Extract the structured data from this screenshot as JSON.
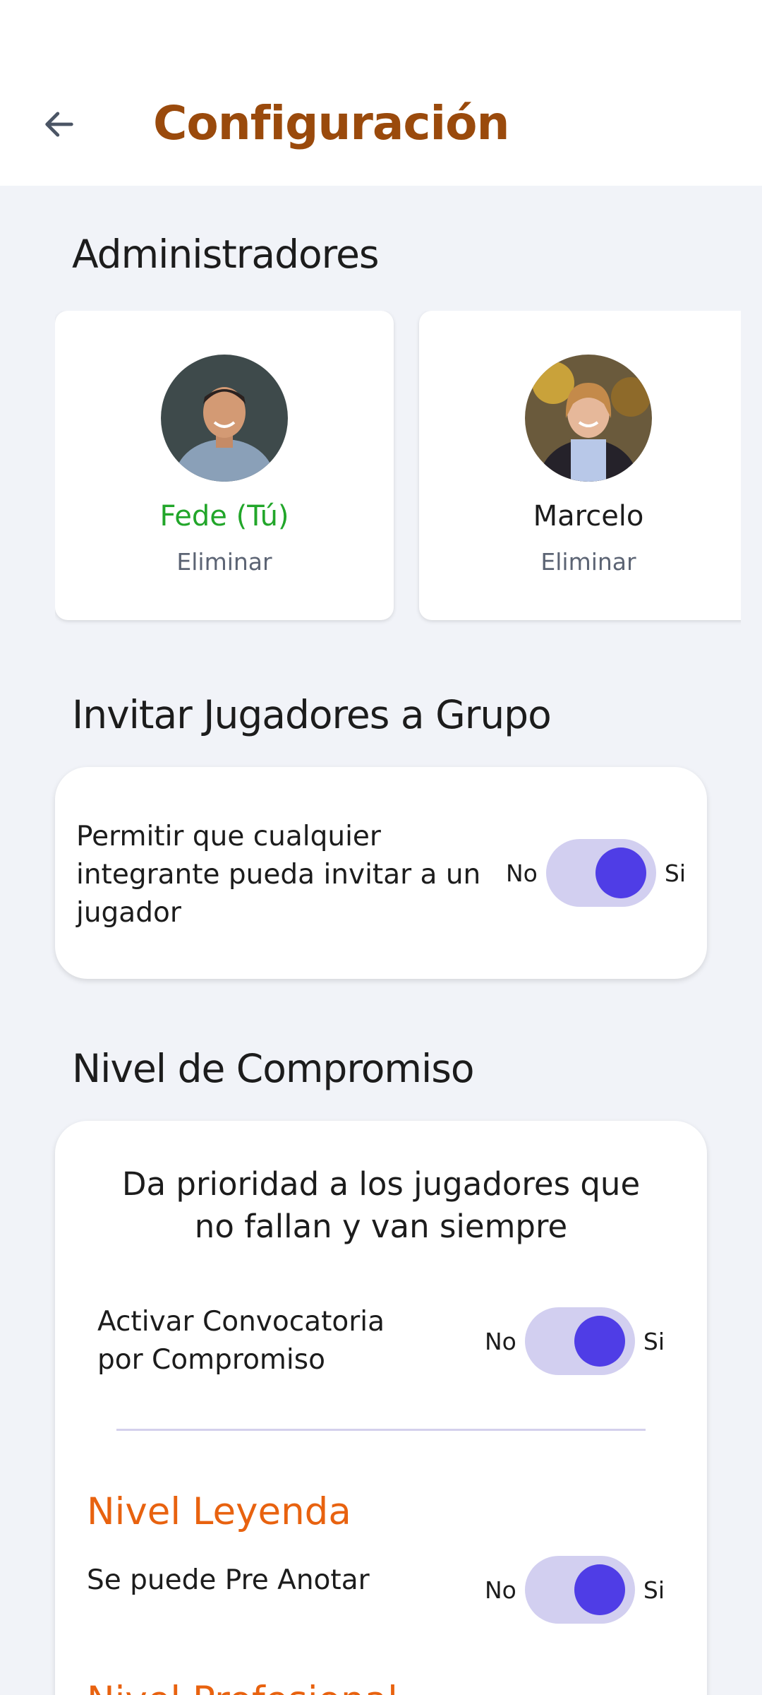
{
  "header": {
    "title": "Configuración"
  },
  "admins": {
    "title": "Administradores",
    "items": [
      {
        "name": "Fede (Tú)",
        "name_color": "#22a62a",
        "action": "Eliminar"
      },
      {
        "name": "Marcelo",
        "name_color": "#1c1c1c",
        "action": "Eliminar"
      }
    ]
  },
  "invite": {
    "title": "Invitar Jugadores a Grupo",
    "setting_label": "Permitir que cualquier integrante pueda invitar a un jugador",
    "toggle": {
      "off_label": "No",
      "on_label": "Si",
      "value": true
    }
  },
  "commitment": {
    "title": "Nivel de Compromiso",
    "description": "Da prioridad a los jugadores que no fallan y van siempre",
    "activate_label": "Activar Convocatoria por Compromiso",
    "activate_toggle": {
      "off_label": "No",
      "on_label": "Si",
      "value": true
    },
    "levels": [
      {
        "name": "Nivel Leyenda",
        "option_label": "Se puede Pre Anotar",
        "toggle": {
          "off_label": "No",
          "on_label": "Si",
          "value": true
        }
      },
      {
        "name": "Nivel Profesional"
      }
    ]
  },
  "colors": {
    "accent": "#4f3de6",
    "toggle_track": "#d2cff0",
    "title": "#9a4a0c",
    "level": "#e8620f"
  }
}
